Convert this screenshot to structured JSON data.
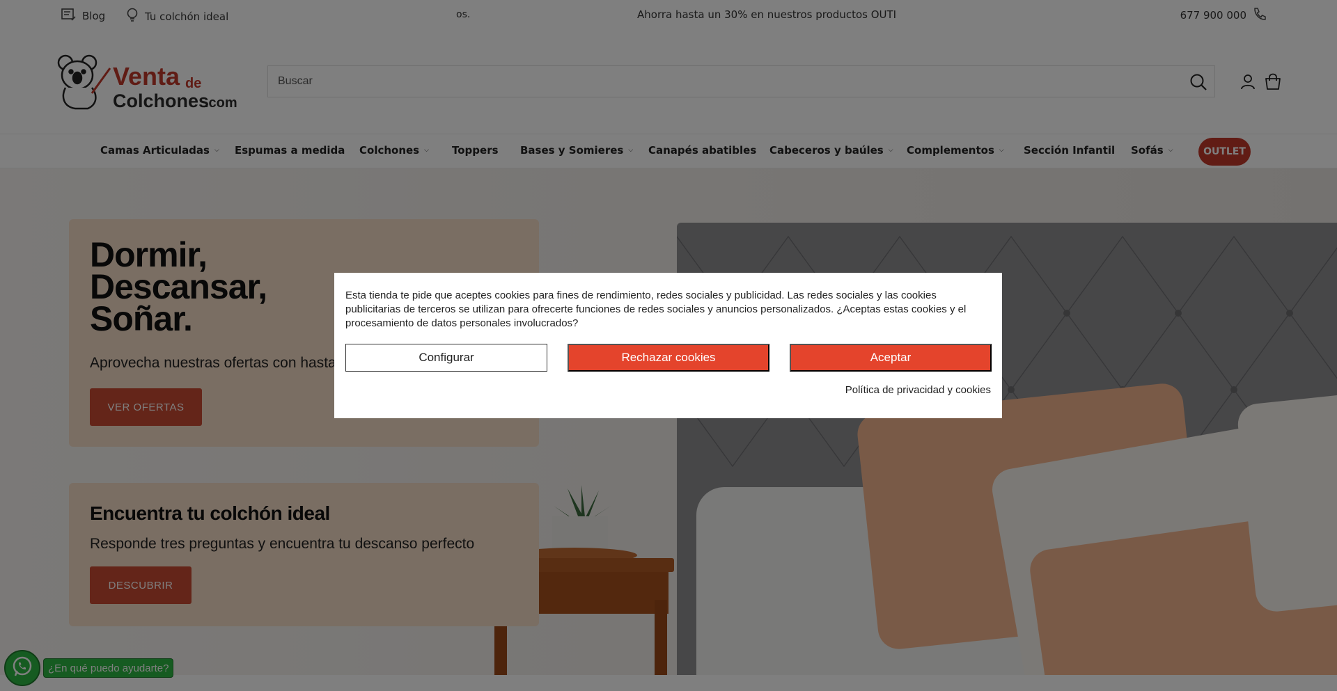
{
  "topbar": {
    "blog": "Blog",
    "ideal_mattress": "Tu colchón ideal",
    "ticker_partial": "os.",
    "promo": "Ahorra hasta un 30% en nuestros productos OUTI",
    "phone": "677 900 000"
  },
  "header": {
    "search_placeholder": "Buscar"
  },
  "nav": {
    "items": [
      {
        "label": "Camas Articuladas",
        "dropdown": true
      },
      {
        "label": "Espumas a medida",
        "dropdown": false
      },
      {
        "label": "Colchones",
        "dropdown": true
      },
      {
        "label": "Toppers",
        "dropdown": false
      },
      {
        "label": "Bases y Somieres",
        "dropdown": true
      },
      {
        "label": "Canapés abatibles",
        "dropdown": false
      },
      {
        "label": "Cabeceros y baúles",
        "dropdown": true
      },
      {
        "label": "Complementos",
        "dropdown": true
      },
      {
        "label": "Sección Infantil",
        "dropdown": false
      },
      {
        "label": "Sofás",
        "dropdown": true
      }
    ],
    "outlet": "OUTLET",
    "chevron": "⌄"
  },
  "hero": {
    "card1": {
      "title_line1": "Dormir,",
      "title_line2": "Descansar,",
      "title_line3": "Soñar.",
      "subtitle": "Aprovecha nuestras ofertas con hasta un",
      "button": "VER OFERTAS"
    },
    "card2": {
      "title": "Encuentra tu colchón ideal",
      "subtitle": "Responde tres preguntas y encuentra tu descanso perfecto",
      "button": "DESCUBRIR"
    }
  },
  "whatsapp": {
    "label": "¿En qué puedo ayudarte?"
  },
  "cookie": {
    "text": "Esta tienda te pide que aceptes cookies para fines de rendimiento, redes sociales y publicidad. Las redes sociales y las cookies publicitarias de terceros se utilizan para ofrecerte funciones de redes sociales y anuncios personalizados. ¿Aceptas estas cookies y el procesamiento de datos personales involucrados?",
    "configure": "Configurar",
    "reject": "Rechazar cookies",
    "accept": "Aceptar",
    "policy": "Política de privacidad y cookies"
  },
  "colors": {
    "accent_red": "#e4442c",
    "outlet_red": "#c2392b",
    "card_peach": "#f4dcc6",
    "whatsapp_green": "#2db742"
  },
  "icons": [
    "blog-icon",
    "lightbulb-icon",
    "phone-icon",
    "search-icon",
    "user-icon",
    "shopping-bag-icon",
    "chevron-down-icon",
    "whatsapp-icon"
  ]
}
